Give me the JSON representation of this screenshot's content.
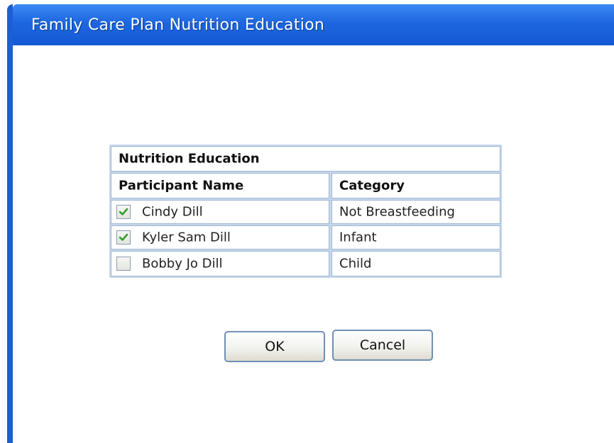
{
  "window": {
    "title": "Family Care Plan Nutrition Education"
  },
  "table": {
    "caption": "Nutrition Education",
    "headers": {
      "name": "Participant Name",
      "category": "Category"
    },
    "rows": [
      {
        "name": "Cindy Dill",
        "category": "Not Breastfeeding",
        "checked": true
      },
      {
        "name": "Kyler Sam Dill",
        "category": "Infant",
        "checked": true
      },
      {
        "name": "Bobby Jo Dill",
        "category": "Child",
        "checked": false
      }
    ]
  },
  "buttons": {
    "ok": "OK",
    "cancel": "Cancel"
  },
  "colors": {
    "titlebar": "#1d66e0",
    "check": "#2e9e2e"
  }
}
